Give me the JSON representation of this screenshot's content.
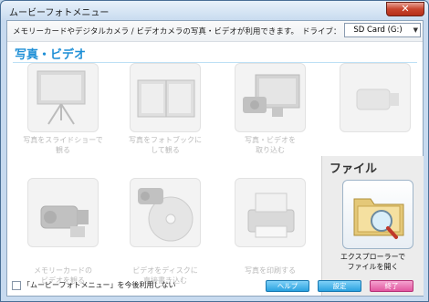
{
  "window": {
    "title": "ムービーフォトメニュー"
  },
  "topbar": {
    "description": "メモリーカードやデジタルカメラ / ビデオカメラの写真・ビデオが利用できます。",
    "drive_label": "ドライブ：",
    "drive_value": "SD Card (G:)"
  },
  "section": {
    "title": "写真・ビデオ"
  },
  "cards": [
    {
      "label_line1": "写真をスライドショーで",
      "label_line2": "観る",
      "icon": "slideshow-icon"
    },
    {
      "label_line1": "写真をフォトブックに",
      "label_line2": "して観る",
      "icon": "photobook-icon"
    },
    {
      "label_line1": "写真・ビデオを",
      "label_line2": "取り込む",
      "icon": "import-icon"
    },
    {
      "label_line1": "",
      "label_line2": "",
      "icon": "camcorder-icon"
    },
    {
      "label_line1": "メモリーカードの",
      "label_line2": "ビデオを観る",
      "icon": "camcorder-card-icon"
    },
    {
      "label_line1": "ビデオをディスクに",
      "label_line2": "直接書き込む",
      "icon": "disc-burn-icon"
    },
    {
      "label_line1": "写真を印刷する",
      "label_line2": "",
      "icon": "printer-icon"
    }
  ],
  "file_panel": {
    "title": "ファイル",
    "explorer_line1": "エクスプローラーで",
    "explorer_line2": "ファイルを開く"
  },
  "footer": {
    "checkbox_label": "「ムービーフォトメニュー」を今後利用しない",
    "help": "ヘルプ",
    "settings": "設定",
    "exit": "終了"
  },
  "colors": {
    "section_title": "#1e8fd6",
    "help_button": "#2aa2e0",
    "exit_button": "#e2559f",
    "close_button": "#c8442d"
  }
}
